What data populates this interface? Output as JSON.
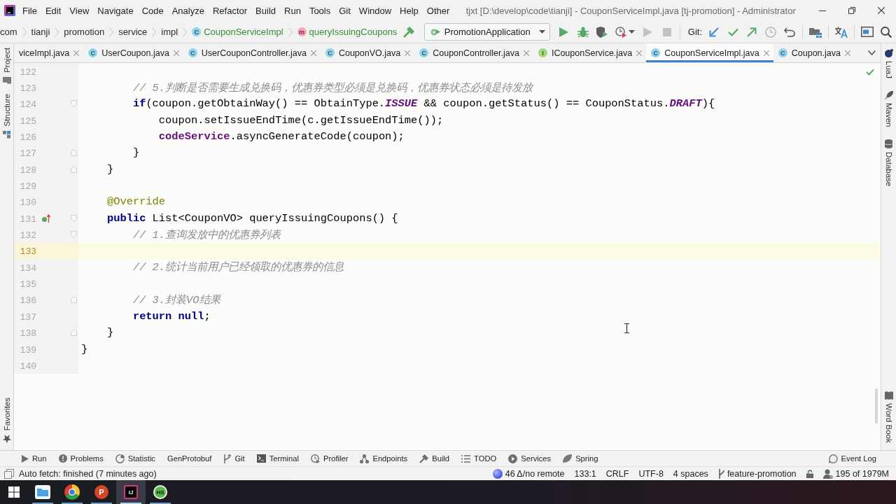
{
  "title_bar": {
    "menu": [
      "File",
      "Edit",
      "View",
      "Navigate",
      "Code",
      "Analyze",
      "Refactor",
      "Build",
      "Run",
      "Tools",
      "Git",
      "Window",
      "Help",
      "Other"
    ],
    "title": "tjxt [D:\\develop\\code\\tianji] - CouponServiceImpl.java [tj-promotion] - Administrator"
  },
  "navigation": {
    "breadcrumbs": [
      {
        "label": "com",
        "kind": "package"
      },
      {
        "label": "tianji",
        "kind": "package"
      },
      {
        "label": "promotion",
        "kind": "package"
      },
      {
        "label": "service",
        "kind": "package"
      },
      {
        "label": "impl",
        "kind": "package"
      },
      {
        "label": "CouponServiceImpl",
        "kind": "class",
        "badge": "C"
      },
      {
        "label": "queryIssuingCoupons",
        "kind": "method",
        "badge": "m"
      }
    ],
    "run_configuration": "PromotionApplication",
    "run_buttons": [
      {
        "kind": "run",
        "disabled": false
      },
      {
        "kind": "debug",
        "disabled": false
      },
      {
        "kind": "coverage",
        "disabled": false
      },
      {
        "kind": "profile",
        "disabled": false
      },
      {
        "kind": "run",
        "disabled": true
      },
      {
        "kind": "stop",
        "disabled": true
      }
    ],
    "git_label": "Git:",
    "git_buttons": [
      {
        "kind": "update"
      },
      {
        "kind": "commit"
      },
      {
        "kind": "push"
      },
      {
        "kind": "history"
      },
      {
        "kind": "rollback"
      }
    ],
    "tool_buttons": [
      {
        "kind": "structure"
      },
      {
        "kind": "translate"
      },
      {
        "kind": "terminal"
      },
      {
        "kind": "search"
      }
    ]
  },
  "left_tool_strip": {
    "top": [
      {
        "label": "Project",
        "kind": "project"
      },
      {
        "label": "Structure",
        "kind": "structure"
      }
    ],
    "bottom": [
      {
        "label": "Favorites",
        "kind": "favorites"
      }
    ]
  },
  "tabs": [
    {
      "label": "viceImpl.java",
      "selected": false
    },
    {
      "label": "UserCoupon.java",
      "kind": "class",
      "badge": "C",
      "selected": false
    },
    {
      "label": "UserCouponController.java",
      "kind": "class",
      "badge": "C",
      "selected": false
    },
    {
      "label": "CouponVO.java",
      "kind": "class",
      "badge": "C",
      "selected": false
    },
    {
      "label": "CouponController.java",
      "kind": "class",
      "badge": "C",
      "selected": false
    },
    {
      "label": "ICouponService.java",
      "kind": "interface",
      "badge": "I",
      "selected": false
    },
    {
      "label": "CouponServiceImpl.java",
      "kind": "class",
      "badge": "C",
      "selected": true
    },
    {
      "label": "Coupon.java",
      "kind": "class",
      "badge": "C",
      "selected": false
    }
  ],
  "editor": {
    "lines": [
      {
        "number": "122",
        "current": false
      },
      {
        "number": "123",
        "current": false,
        "tokens": [
          {
            "kind": "comment",
            "text": "        // 5.判断是否需要生成兑换码，优惠券类型必须是兑换码，优惠券状态必须是待发放"
          }
        ]
      },
      {
        "number": "124",
        "current": false,
        "gutter": [
          {
            "kind": "foldstart"
          }
        ],
        "tokens": [
          {
            "kind": "keyword",
            "text": "        if"
          },
          {
            "kind": "plain",
            "text": "(coupon.getObtainWay() == ObtainType."
          },
          {
            "kind": "constant",
            "text": "ISSUE"
          },
          {
            "kind": "plain",
            "text": " && coupon.getStatus() == CouponStatus."
          },
          {
            "kind": "constant",
            "text": "DRAFT"
          },
          {
            "kind": "plain",
            "text": "){"
          }
        ]
      },
      {
        "number": "125",
        "current": false,
        "tokens": [
          {
            "kind": "plain",
            "text": "            coupon.setIssueEndTime(c.getIssueEndTime());"
          }
        ]
      },
      {
        "number": "126",
        "current": false,
        "tokens": [
          {
            "kind": "field",
            "text": "            codeService"
          },
          {
            "kind": "plain",
            "text": ".asyncGenerateCode(coupon);"
          }
        ]
      },
      {
        "number": "127",
        "current": false,
        "gutter": [
          {
            "kind": "foldend"
          }
        ],
        "tokens": [
          {
            "kind": "plain",
            "text": "        }"
          }
        ]
      },
      {
        "number": "128",
        "current": false,
        "gutter": [
          {
            "kind": "foldend"
          }
        ],
        "tokens": [
          {
            "kind": "plain",
            "text": "    }"
          }
        ]
      },
      {
        "number": "129",
        "current": false
      },
      {
        "number": "130",
        "current": false,
        "tokens": [
          {
            "kind": "annotation",
            "text": "    @Override"
          }
        ]
      },
      {
        "number": "131",
        "current": false,
        "gutter": [
          {
            "kind": "implements"
          },
          {
            "kind": "foldstart"
          }
        ],
        "tokens": [
          {
            "kind": "keyword",
            "text": "    public"
          },
          {
            "kind": "plain",
            "text": " List<CouponVO> queryIssuingCoupons() {"
          }
        ]
      },
      {
        "number": "132",
        "current": false,
        "gutter": [
          {
            "kind": "foldstart"
          }
        ],
        "tokens": [
          {
            "kind": "comment",
            "text": "        // 1.查询发放中的优惠券列表"
          }
        ]
      },
      {
        "number": "133",
        "current": true
      },
      {
        "number": "134",
        "current": false,
        "tokens": [
          {
            "kind": "comment",
            "text": "        // 2.统计当前用户已经领取的优惠券的信息"
          }
        ]
      },
      {
        "number": "135",
        "current": false
      },
      {
        "number": "136",
        "current": false,
        "gutter": [
          {
            "kind": "foldend"
          }
        ],
        "tokens": [
          {
            "kind": "comment",
            "text": "        // 3.封装VO结果"
          }
        ]
      },
      {
        "number": "137",
        "current": false,
        "tokens": [
          {
            "kind": "keyword",
            "text": "        return null"
          },
          {
            "kind": "plain",
            "text": ";"
          }
        ]
      },
      {
        "number": "138",
        "current": false,
        "gutter": [
          {
            "kind": "foldend"
          }
        ],
        "tokens": [
          {
            "kind": "plain",
            "text": "    }"
          }
        ]
      },
      {
        "number": "139",
        "current": false,
        "tokens": [
          {
            "kind": "plain",
            "text": "}"
          }
        ]
      },
      {
        "number": "140",
        "current": false
      }
    ]
  },
  "right_tool_strip": {
    "top": [
      {
        "label": "LuaJ",
        "kind": "luaj"
      },
      {
        "label": "Maven",
        "kind": "maven"
      },
      {
        "label": "Database",
        "kind": "database"
      }
    ],
    "bottom": [
      {
        "label": "Word Book",
        "kind": "book"
      }
    ]
  },
  "tool_windows": {
    "left": [
      {
        "label": "Run",
        "kind": "run"
      },
      {
        "label": "Problems",
        "kind": "problems"
      },
      {
        "label": "Statistic",
        "kind": "statistic"
      },
      {
        "label": "GenProtobuf",
        "kind": "plain"
      },
      {
        "label": "Git",
        "kind": "git"
      },
      {
        "label": "Terminal",
        "kind": "terminal"
      },
      {
        "label": "Profiler",
        "kind": "profiler"
      },
      {
        "label": "Endpoints",
        "kind": "endpoints"
      },
      {
        "label": "Build",
        "kind": "build"
      },
      {
        "label": "TODO",
        "kind": "todo"
      },
      {
        "label": "Services",
        "kind": "services"
      },
      {
        "label": "Spring",
        "kind": "spring"
      }
    ],
    "right": [
      {
        "label": "Event Log",
        "kind": "log"
      }
    ]
  },
  "status_bar": {
    "message": "Auto fetch: finished (7 minutes ago)",
    "widgets": [
      {
        "kind": "changes",
        "label": "46 Δ/no remote"
      },
      {
        "kind": "text",
        "label": "133:1"
      },
      {
        "kind": "text",
        "label": "CRLF"
      },
      {
        "kind": "text",
        "label": "UTF-8"
      },
      {
        "kind": "text",
        "label": "4 spaces"
      },
      {
        "kind": "branch",
        "label": "feature-promotion"
      },
      {
        "kind": "lock"
      },
      {
        "kind": "memory",
        "label": "195 of 1979M"
      }
    ]
  },
  "taskbar": {
    "apps": [
      {
        "kind": "folder",
        "selected": false
      },
      {
        "kind": "browser",
        "selected": false
      },
      {
        "kind": "slides",
        "glyph": "P",
        "selected": false
      },
      {
        "kind": "ide",
        "glyph": "IJ",
        "selected": true
      },
      {
        "kind": "round",
        "glyph": "HS",
        "selected": false
      }
    ]
  }
}
